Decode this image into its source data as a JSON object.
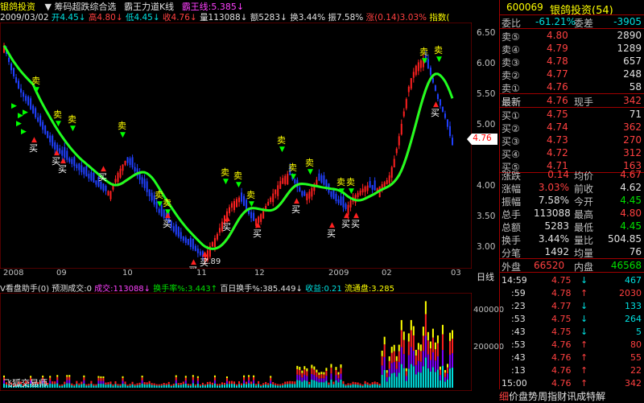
{
  "header": {
    "stock_name": "银鸽投资",
    "indicator1": "筹码超跌综合选",
    "indicator2": "霸王力道K线",
    "indicator3_label": "霸王线:",
    "indicator3_value": "5.385",
    "indicator3_arrow": "↓"
  },
  "infobar": {
    "date": "2009/03/02",
    "open": "开4.45",
    "high": "高4.80",
    "low": "低4.45",
    "close": "收4.76",
    "vol": "量113088",
    "amount": "额5283",
    "turnover": "换3.44%",
    "amplitude": "振7.58%",
    "change": "涨(0.14)3.03%",
    "index": "指数("
  },
  "price_axis": [
    "6.50",
    "6.00",
    "5.50",
    "5.00",
    "4.50",
    "4.00",
    "3.50",
    "3.00"
  ],
  "current_price_tag": "4.76",
  "x_axis": [
    "2008",
    "09",
    "10",
    "11",
    "12",
    "2009",
    "02",
    "03"
  ],
  "low_label": "2.89",
  "signals": {
    "sell": "卖",
    "buy": "买"
  },
  "volume": {
    "title": "V看盘助手(0)",
    "predict": "预测成交:0",
    "vol": "成交:113088↓",
    "turnover_rate": "换手率%:3.443↑",
    "hundred_day": "百日换手%:385.449↓",
    "income": "收益:0.21",
    "float": "流通盘:3.285",
    "axis": [
      "400000",
      "200000"
    ],
    "watermark": "飞狐交易师"
  },
  "quote": {
    "code": "600069",
    "name": "银鸽投资(54)",
    "weibi_label": "委比",
    "weibi_value": "-61.21%",
    "weicha_label": "委差",
    "weicha_value": "-3905",
    "sell": [
      {
        "label": "卖⑤",
        "price": "4.80",
        "vol": "2890"
      },
      {
        "label": "卖④",
        "price": "4.79",
        "vol": "1289"
      },
      {
        "label": "卖③",
        "price": "4.78",
        "vol": "657"
      },
      {
        "label": "卖②",
        "price": "4.77",
        "vol": "248"
      },
      {
        "label": "卖①",
        "price": "4.76",
        "vol": "58"
      }
    ],
    "latest_label": "最新",
    "latest_price": "4.76",
    "xianshou_label": "现手",
    "xianshou_value": "342",
    "buy": [
      {
        "label": "买①",
        "price": "4.75",
        "vol": "71"
      },
      {
        "label": "买②",
        "price": "4.74",
        "vol": "362"
      },
      {
        "label": "买③",
        "price": "4.73",
        "vol": "270"
      },
      {
        "label": "买④",
        "price": "4.72",
        "vol": "312"
      },
      {
        "label": "买⑤",
        "price": "4.71",
        "vol": "163"
      }
    ],
    "stats": [
      {
        "l1": "涨跌",
        "v1": "0.14",
        "c1": "red",
        "l2": "均价",
        "v2": "4.67",
        "c2": "red"
      },
      {
        "l1": "涨幅",
        "v1": "3.03%",
        "c1": "red",
        "l2": "前收",
        "v2": "4.62",
        "c2": "wht"
      },
      {
        "l1": "振幅",
        "v1": "7.58%",
        "c1": "wht",
        "l2": "今开",
        "v2": "4.45",
        "c2": "grn"
      },
      {
        "l1": "总手",
        "v1": "113088",
        "c1": "wht",
        "l2": "最高",
        "v2": "4.80",
        "c2": "red"
      },
      {
        "l1": "总额",
        "v1": "5283",
        "c1": "wht",
        "l2": "最低",
        "v2": "4.45",
        "c2": "grn"
      },
      {
        "l1": "换手",
        "v1": "3.44%",
        "c1": "wht",
        "l2": "量比",
        "v2": "504.85",
        "c2": "wht"
      },
      {
        "l1": "分笔",
        "v1": "1492",
        "c1": "wht",
        "l2": "均量",
        "v2": "76",
        "c2": "wht"
      }
    ],
    "outer_label": "外盘",
    "outer_value": "66520",
    "inner_label": "内盘",
    "inner_value": "46568",
    "ticks": [
      {
        "t": "14:59",
        "p": "4.75",
        "a": "↓",
        "ac": "cyan",
        "v": "467",
        "vc": "cyan"
      },
      {
        "t": ":59",
        "p": "4.78",
        "a": "↑",
        "ac": "red",
        "v": "2030",
        "vc": "red"
      },
      {
        "t": ":23",
        "p": "4.77",
        "a": "↓",
        "ac": "cyan",
        "v": "133",
        "vc": "cyan"
      },
      {
        "t": ":53",
        "p": "4.75",
        "a": "↓",
        "ac": "cyan",
        "v": "264",
        "vc": "cyan"
      },
      {
        "t": ":43",
        "p": "4.75",
        "a": "↓",
        "ac": "cyan",
        "v": "5",
        "vc": "cyan"
      },
      {
        "t": ":53",
        "p": "4.76",
        "a": "↑",
        "ac": "red",
        "v": "80",
        "vc": "red"
      },
      {
        "t": ":43",
        "p": "4.76",
        "a": "↑",
        "ac": "red",
        "v": "55",
        "vc": "red"
      },
      {
        "t": ":13",
        "p": "4.76",
        "a": "↑",
        "ac": "red",
        "v": "22",
        "vc": "red"
      },
      {
        "t": "15:00",
        "p": "4.76",
        "a": "↑",
        "ac": "red",
        "v": "342",
        "vc": "red"
      }
    ],
    "daily_label": "日线",
    "tabs": [
      "细",
      "价",
      "盘",
      "势",
      "周",
      "指",
      "财",
      "讯",
      "成",
      "特",
      "解"
    ]
  },
  "chart_data": {
    "type": "candlestick",
    "ylim": [
      2.8,
      6.7
    ],
    "x": [
      "2008",
      "09",
      "10",
      "11",
      "12",
      "2009",
      "02",
      "03"
    ],
    "close": [
      6.4,
      6.0,
      5.7,
      5.5,
      5.3,
      5.1,
      4.9,
      4.7,
      4.6,
      4.5,
      4.4,
      4.3,
      4.2,
      4.1,
      4.0,
      4.0,
      4.3,
      4.5,
      4.4,
      4.2,
      4.0,
      3.8,
      3.6,
      3.5,
      3.3,
      3.2,
      3.1,
      3.0,
      2.9,
      3.1,
      3.3,
      3.6,
      3.8,
      3.9,
      3.7,
      3.5,
      3.6,
      3.8,
      4.0,
      4.2,
      4.3,
      4.1,
      3.9,
      4.0,
      4.2,
      4.1,
      3.9,
      3.8,
      3.7,
      3.9,
      4.0,
      4.1,
      4.0,
      4.1,
      4.2,
      4.6,
      5.2,
      5.8,
      6.1,
      6.2,
      5.9,
      5.5,
      5.2,
      4.76
    ]
  }
}
